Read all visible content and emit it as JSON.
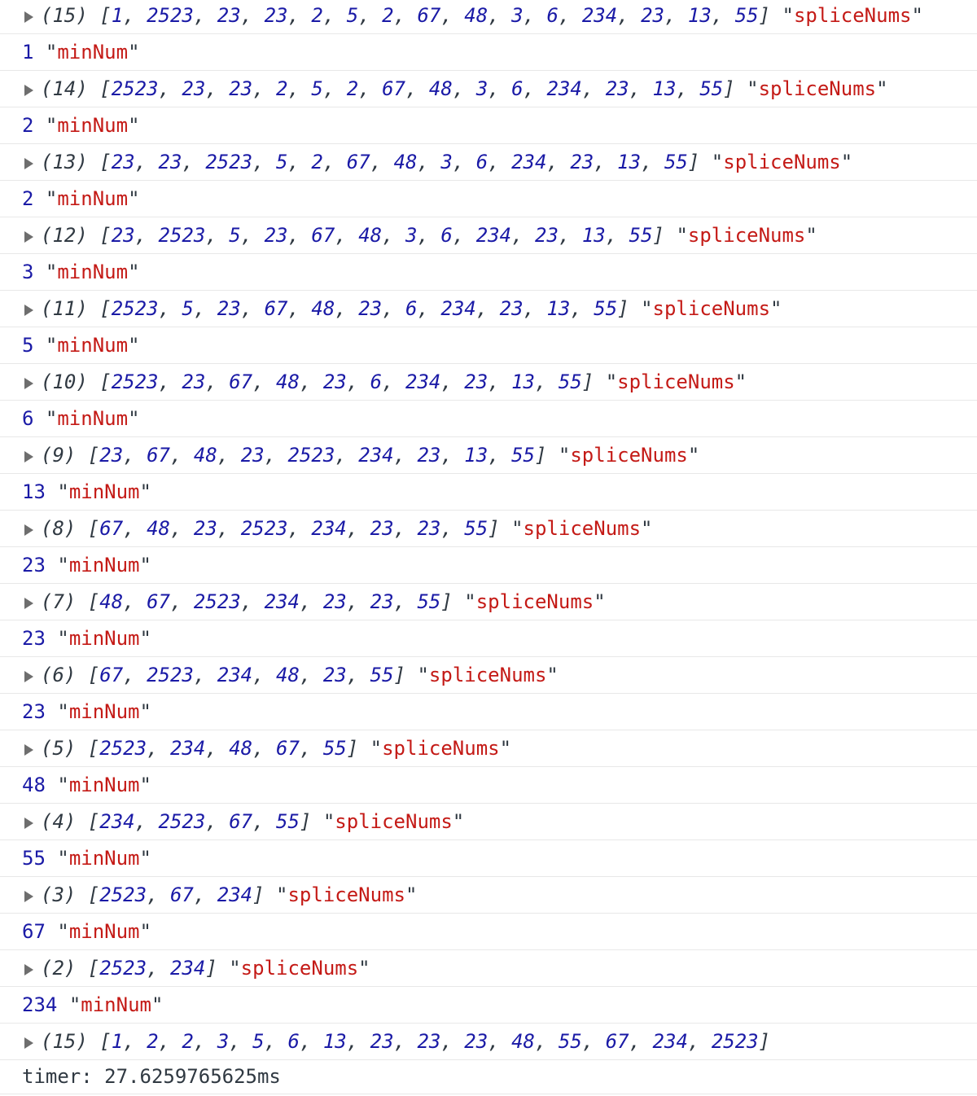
{
  "colors": {
    "number": "#1a1aa6",
    "string": "#c41a16",
    "text": "#303942",
    "separator": "#e8e8e8",
    "expand_triangle": "#6e6e6e"
  },
  "icons": {
    "expand": "expand-triangle-icon"
  },
  "entries": [
    {
      "type": "array",
      "length": 15,
      "values": [
        1,
        2523,
        23,
        23,
        2,
        5,
        2,
        67,
        48,
        3,
        6,
        234,
        23,
        13,
        55
      ],
      "label": "spliceNums"
    },
    {
      "type": "number",
      "value": 1,
      "label": "minNum"
    },
    {
      "type": "array",
      "length": 14,
      "values": [
        2523,
        23,
        23,
        2,
        5,
        2,
        67,
        48,
        3,
        6,
        234,
        23,
        13,
        55
      ],
      "label": "spliceNums"
    },
    {
      "type": "number",
      "value": 2,
      "label": "minNum"
    },
    {
      "type": "array",
      "length": 13,
      "values": [
        23,
        23,
        2523,
        5,
        2,
        67,
        48,
        3,
        6,
        234,
        23,
        13,
        55
      ],
      "label": "spliceNums"
    },
    {
      "type": "number",
      "value": 2,
      "label": "minNum"
    },
    {
      "type": "array",
      "length": 12,
      "values": [
        23,
        2523,
        5,
        23,
        67,
        48,
        3,
        6,
        234,
        23,
        13,
        55
      ],
      "label": "spliceNums"
    },
    {
      "type": "number",
      "value": 3,
      "label": "minNum"
    },
    {
      "type": "array",
      "length": 11,
      "values": [
        2523,
        5,
        23,
        67,
        48,
        23,
        6,
        234,
        23,
        13,
        55
      ],
      "label": "spliceNums"
    },
    {
      "type": "number",
      "value": 5,
      "label": "minNum"
    },
    {
      "type": "array",
      "length": 10,
      "values": [
        2523,
        23,
        67,
        48,
        23,
        6,
        234,
        23,
        13,
        55
      ],
      "label": "spliceNums"
    },
    {
      "type": "number",
      "value": 6,
      "label": "minNum"
    },
    {
      "type": "array",
      "length": 9,
      "values": [
        23,
        67,
        48,
        23,
        2523,
        234,
        23,
        13,
        55
      ],
      "label": "spliceNums"
    },
    {
      "type": "number",
      "value": 13,
      "label": "minNum"
    },
    {
      "type": "array",
      "length": 8,
      "values": [
        67,
        48,
        23,
        2523,
        234,
        23,
        23,
        55
      ],
      "label": "spliceNums"
    },
    {
      "type": "number",
      "value": 23,
      "label": "minNum"
    },
    {
      "type": "array",
      "length": 7,
      "values": [
        48,
        67,
        2523,
        234,
        23,
        23,
        55
      ],
      "label": "spliceNums"
    },
    {
      "type": "number",
      "value": 23,
      "label": "minNum"
    },
    {
      "type": "array",
      "length": 6,
      "values": [
        67,
        2523,
        234,
        48,
        23,
        55
      ],
      "label": "spliceNums"
    },
    {
      "type": "number",
      "value": 23,
      "label": "minNum"
    },
    {
      "type": "array",
      "length": 5,
      "values": [
        2523,
        234,
        48,
        67,
        55
      ],
      "label": "spliceNums"
    },
    {
      "type": "number",
      "value": 48,
      "label": "minNum"
    },
    {
      "type": "array",
      "length": 4,
      "values": [
        234,
        2523,
        67,
        55
      ],
      "label": "spliceNums"
    },
    {
      "type": "number",
      "value": 55,
      "label": "minNum"
    },
    {
      "type": "array",
      "length": 3,
      "values": [
        2523,
        67,
        234
      ],
      "label": "spliceNums"
    },
    {
      "type": "number",
      "value": 67,
      "label": "minNum"
    },
    {
      "type": "array",
      "length": 2,
      "values": [
        2523,
        234
      ],
      "label": "spliceNums"
    },
    {
      "type": "number",
      "value": 234,
      "label": "minNum"
    },
    {
      "type": "array",
      "length": 15,
      "values": [
        1,
        2,
        2,
        3,
        5,
        6,
        13,
        23,
        23,
        23,
        48,
        55,
        67,
        234,
        2523
      ],
      "label": ""
    }
  ],
  "timer": {
    "text": "timer: 27.6259765625ms"
  }
}
